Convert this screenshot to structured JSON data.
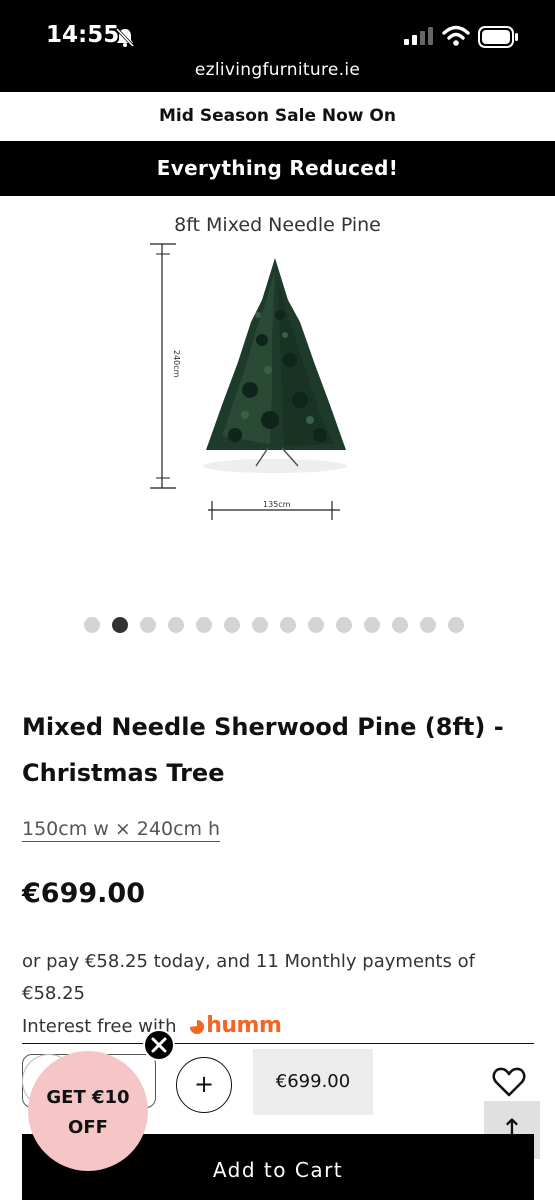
{
  "status_bar": {
    "time": "14:55",
    "url": "ezlivingfurniture.ie"
  },
  "banners": {
    "top": "Mid Season Sale Now On",
    "bottom": "Everything Reduced!"
  },
  "gallery": {
    "caption": "8ft Mixed Needle Pine",
    "height_label": "240cm",
    "width_label": "135cm",
    "total_slides": 14,
    "active_slide": 2
  },
  "product": {
    "title": "Mixed Needle Sherwood Pine (8ft) - Christmas Tree",
    "dimensions": "150cm w × 240cm h",
    "price": "€699.00",
    "finance_text": "or pay €58.25 today, and 11 Monthly payments of €58.25",
    "finance_interest": "Interest free with",
    "finance_brand": "humm"
  },
  "purchase": {
    "plus_label": "+",
    "price_box": "€699.00",
    "add_to_cart": "Add to Cart",
    "scroll_top": "↑"
  },
  "offer": {
    "line1": "GET €10",
    "line2": "OFF"
  },
  "colors": {
    "brand_orange": "#f26522",
    "offer_pink": "#f6c6c6",
    "black": "#000000"
  },
  "icons": [
    "bell-off-icon",
    "signal-icon",
    "wifi-icon",
    "battery-icon",
    "heart-icon",
    "close-icon",
    "arrow-up-icon"
  ]
}
